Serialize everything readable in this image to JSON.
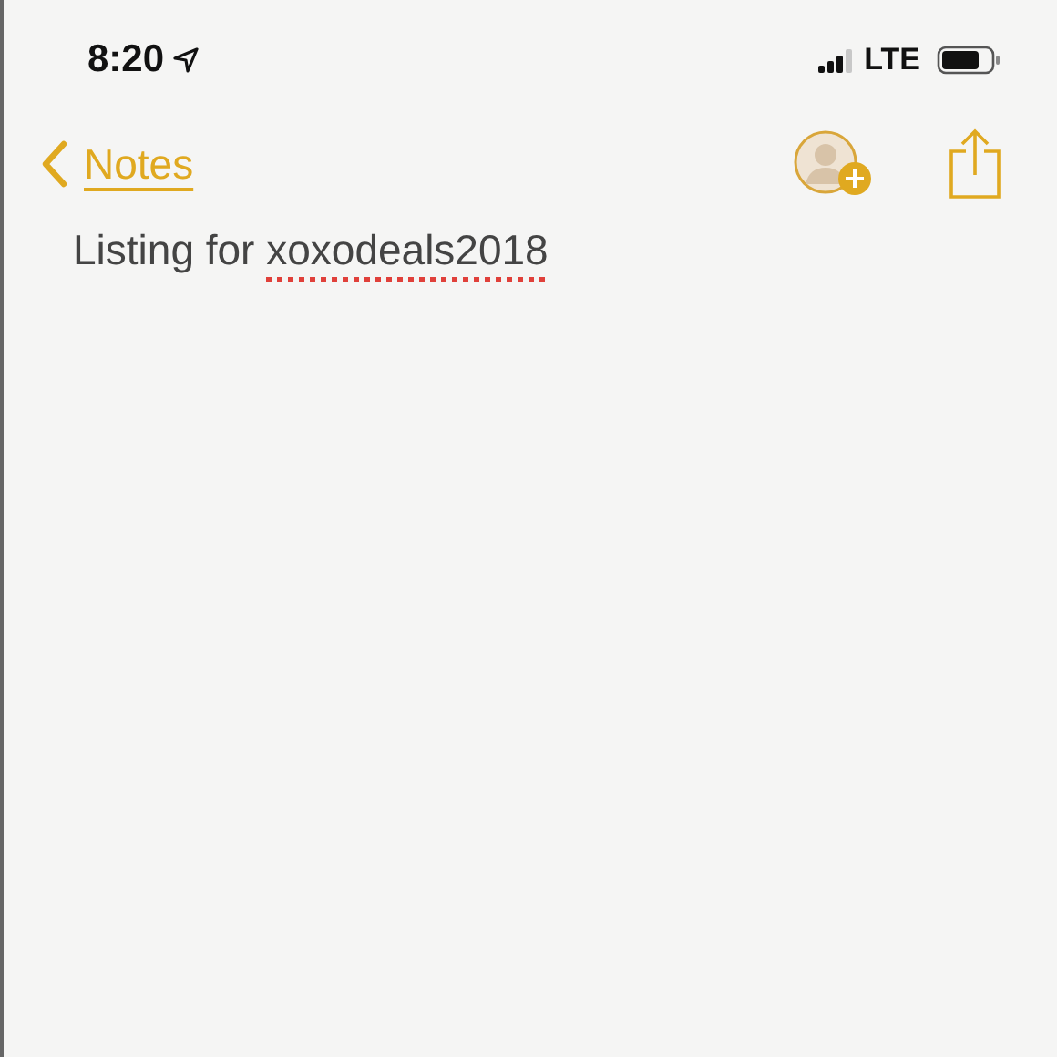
{
  "status_bar": {
    "time": "8:20",
    "network": "LTE"
  },
  "nav": {
    "back_label": "Notes"
  },
  "note": {
    "text": "Listing for",
    "misspelled_word": "xoxodeals2018"
  }
}
